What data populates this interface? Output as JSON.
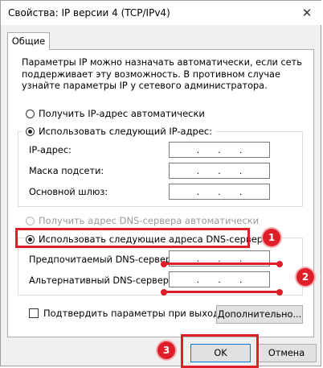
{
  "window": {
    "title": "Свойства: IP версии 4 (TCP/IPv4)",
    "close_glyph": "✕"
  },
  "tabs": [
    {
      "label": "Общие",
      "active": true
    }
  ],
  "description": "Параметры IP можно назначать автоматически, если сеть поддерживает эту возможность. В противном случае узнайте параметры IP у сетевого администратора.",
  "ip_section": {
    "auto_label": "Получить IP-адрес автоматически",
    "manual_label": "Использовать следующий IP-адрес:",
    "selected": "manual",
    "fields": [
      {
        "label": "IP-адрес:",
        "value": ". . ."
      },
      {
        "label": "Маска подсети:",
        "value": ". . ."
      },
      {
        "label": "Основной шлюз:",
        "value": ". . ."
      }
    ]
  },
  "dns_section": {
    "auto_label": "Получить адрес DNS-сервера автоматически",
    "auto_disabled": true,
    "manual_label": "Использовать следующие адреса DNS-серверов:",
    "selected": "manual",
    "fields": [
      {
        "label": "Предпочитаемый DNS-сервер:",
        "value": ". . ."
      },
      {
        "label": "Альтернативный DNS-сервер:",
        "value": ". . ."
      }
    ]
  },
  "validate_checkbox": {
    "label": "Подтвердить параметры при выходе",
    "checked": false
  },
  "buttons": {
    "advanced": "Дополнительно...",
    "ok": "OK",
    "cancel": "Отмена"
  },
  "annotations": {
    "color": "#e01e2a",
    "badges": [
      "1",
      "2",
      "3"
    ]
  }
}
